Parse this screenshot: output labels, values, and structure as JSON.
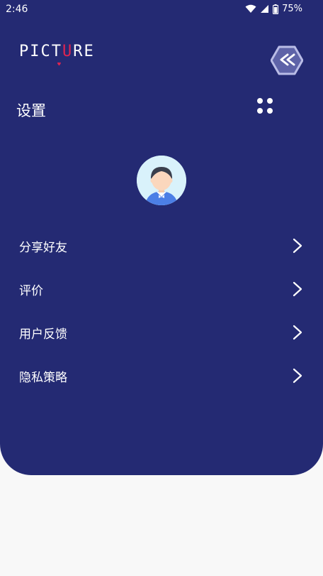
{
  "status_bar": {
    "time": "2:46",
    "battery": "75%"
  },
  "brand": {
    "logo_prefix": "PICT",
    "logo_accent": "U",
    "logo_suffix": "RE"
  },
  "header": {
    "title": "设置"
  },
  "menu": {
    "items": [
      {
        "label": "分享好友"
      },
      {
        "label": "评价"
      },
      {
        "label": "用户反馈"
      },
      {
        "label": "隐私策略"
      }
    ]
  },
  "colors": {
    "panel": "#242a73",
    "background": "#f8f8f8",
    "logo_accent": "#e02450"
  },
  "icons": [
    "wifi-icon",
    "cellular-signal-icon",
    "battery-icon",
    "back-badge-icon",
    "grid-dots-icon",
    "avatar-icon",
    "chevron-right-icon"
  ]
}
